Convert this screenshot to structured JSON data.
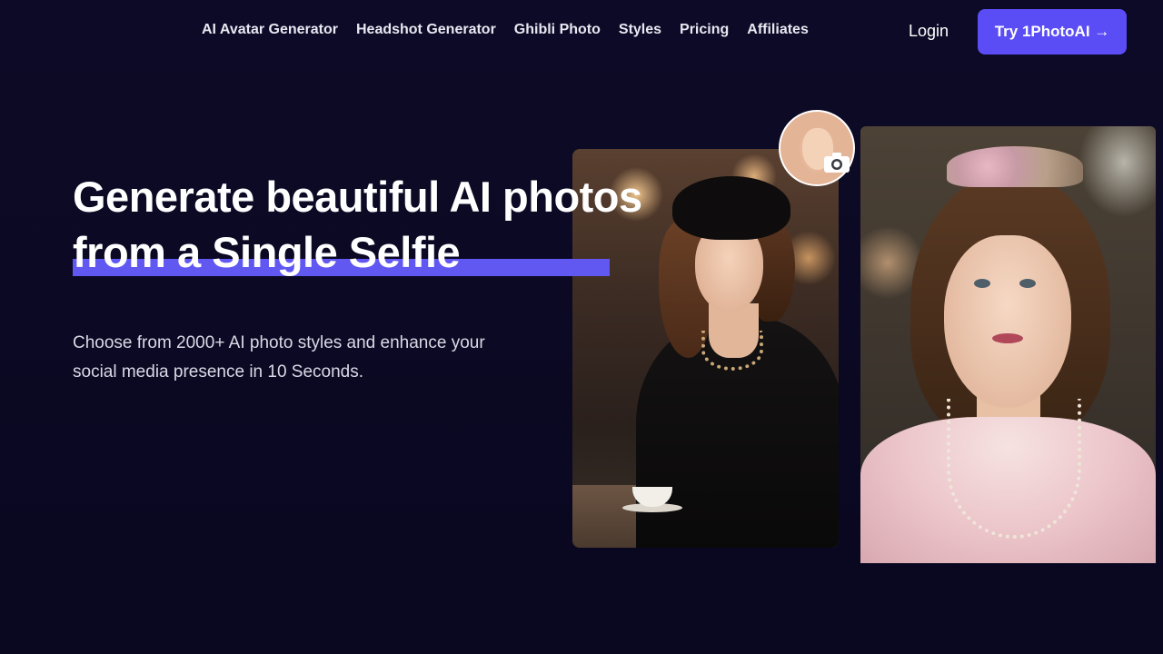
{
  "nav": {
    "links": [
      "AI Avatar Generator",
      "Headshot Generator",
      "Ghibli Photo",
      "Styles",
      "Pricing",
      "Affiliates"
    ],
    "login": "Login",
    "cta": "Try 1PhotoAI →"
  },
  "hero": {
    "title_line1": "Generate beautiful AI photos",
    "title_line2": "from a Single Selfie",
    "subtitle": "Choose from 2000+ AI photo styles and enhance your social media presence in 10 Seconds."
  },
  "icons": {
    "camera": "camera-icon",
    "arrow": "arrow-right-icon"
  },
  "colors": {
    "background": "#0b0923",
    "accent": "#5b4df5",
    "underline": "#6158f2",
    "text": "#ffffff"
  }
}
